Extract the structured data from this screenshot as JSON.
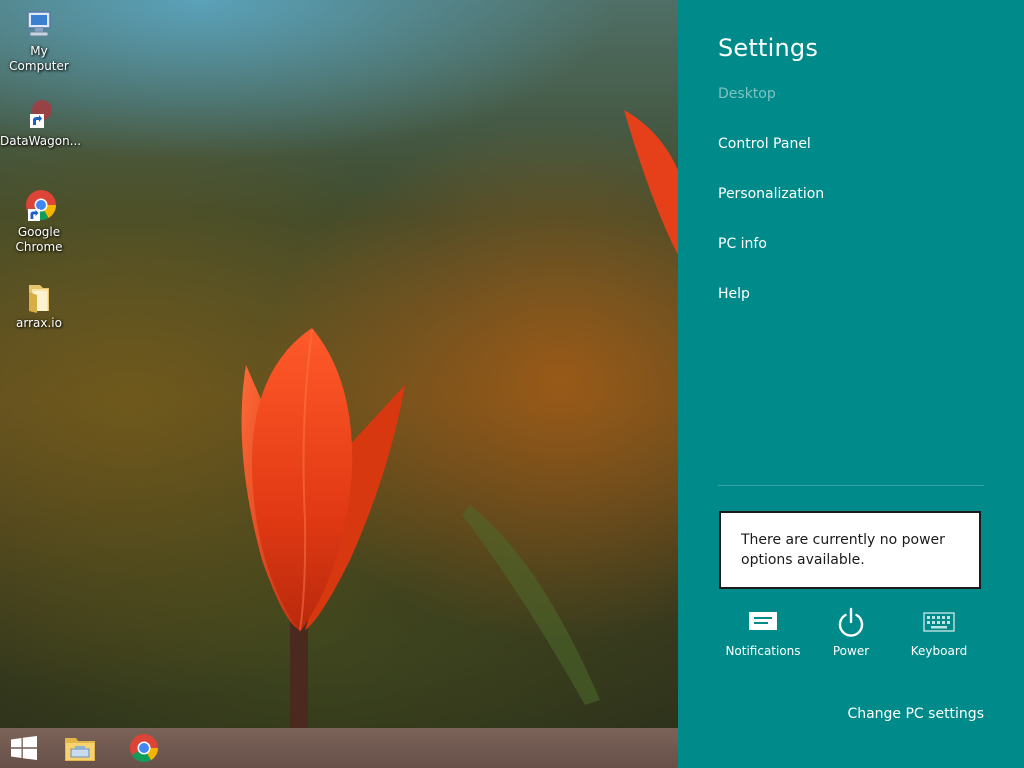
{
  "desktop": {
    "icons": [
      {
        "label": "My Computer",
        "icon": "computer-icon"
      },
      {
        "label": "DataWagon...",
        "icon": "shortcut-icon"
      },
      {
        "label": "Google Chrome",
        "icon": "chrome-icon"
      },
      {
        "label": "arrax.io",
        "icon": "folder-icon"
      }
    ]
  },
  "taskbar": {
    "items": [
      {
        "icon": "windows-start-icon"
      },
      {
        "icon": "file-explorer-icon"
      },
      {
        "icon": "chrome-icon"
      }
    ]
  },
  "settings_charm": {
    "title": "Settings",
    "context": "Desktop",
    "links": [
      "Control Panel",
      "Personalization",
      "PC info",
      "Help"
    ],
    "power_message": "There are currently no power options available.",
    "quick_actions": [
      {
        "label": "Notifications",
        "icon": "notifications-icon"
      },
      {
        "label": "Power",
        "icon": "power-icon"
      },
      {
        "label": "Keyboard",
        "icon": "keyboard-icon"
      }
    ],
    "change_pc_settings": "Change PC settings",
    "background_color": "#008a8a"
  }
}
